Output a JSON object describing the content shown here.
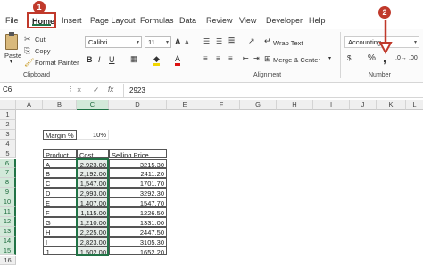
{
  "badges": {
    "one": "1",
    "two": "2"
  },
  "menu": {
    "file": "File",
    "home": "Home",
    "insert": "Insert",
    "page_layout": "Page Layout",
    "formulas": "Formulas",
    "data": "Data",
    "review": "Review",
    "view": "View",
    "developer": "Developer",
    "help": "Help"
  },
  "clipboard": {
    "paste": "Paste",
    "cut": "Cut",
    "copy": "Copy",
    "format_painter": "Format Painter",
    "label": "Clipboard"
  },
  "font": {
    "name": "Calibri",
    "size": "11",
    "bold": "B",
    "italic": "I",
    "underline": "U",
    "grow": "A",
    "shrink": "A"
  },
  "alignment": {
    "wrap_text": "Wrap Text",
    "merge_center": "Merge & Center",
    "label": "Alignment"
  },
  "number": {
    "format": "Accounting",
    "currency": "$",
    "percent": "%",
    "comma": ",",
    "label": "Number"
  },
  "formula_bar": {
    "name_box": "C6",
    "cancel": "×",
    "enter": "✓",
    "fx": "fx",
    "value": "2923"
  },
  "columns": [
    "A",
    "B",
    "C",
    "D",
    "E",
    "F",
    "G",
    "H",
    "I",
    "J",
    "K",
    "L"
  ],
  "rows": [
    "1",
    "2",
    "3",
    "4",
    "5",
    "6",
    "7",
    "8",
    "9",
    "10",
    "11",
    "12",
    "13",
    "14",
    "15",
    "16"
  ],
  "sheet": {
    "margin_label": "Margin %",
    "margin_value": "10%",
    "headers": [
      "Product",
      "Cost",
      "Selling Price"
    ],
    "table": [
      [
        "A",
        "2,923.00",
        "3215.30"
      ],
      [
        "B",
        "2,192.00",
        "2411.20"
      ],
      [
        "C",
        "1,547.00",
        "1701.70"
      ],
      [
        "D",
        "2,993.00",
        "3292.30"
      ],
      [
        "E",
        "1,407.00",
        "1547.70"
      ],
      [
        "F",
        "1,115.00",
        "1226.50"
      ],
      [
        "G",
        "1,210.00",
        "1331.00"
      ],
      [
        "H",
        "2,225.00",
        "2447.50"
      ],
      [
        "I",
        "2,823.00",
        "3105.30"
      ],
      [
        "J",
        "1,502.00",
        "1652.20"
      ]
    ]
  },
  "colors": {
    "excel_green": "#217346",
    "highlight_red": "#c0392b",
    "header_gray": "#efefef"
  }
}
